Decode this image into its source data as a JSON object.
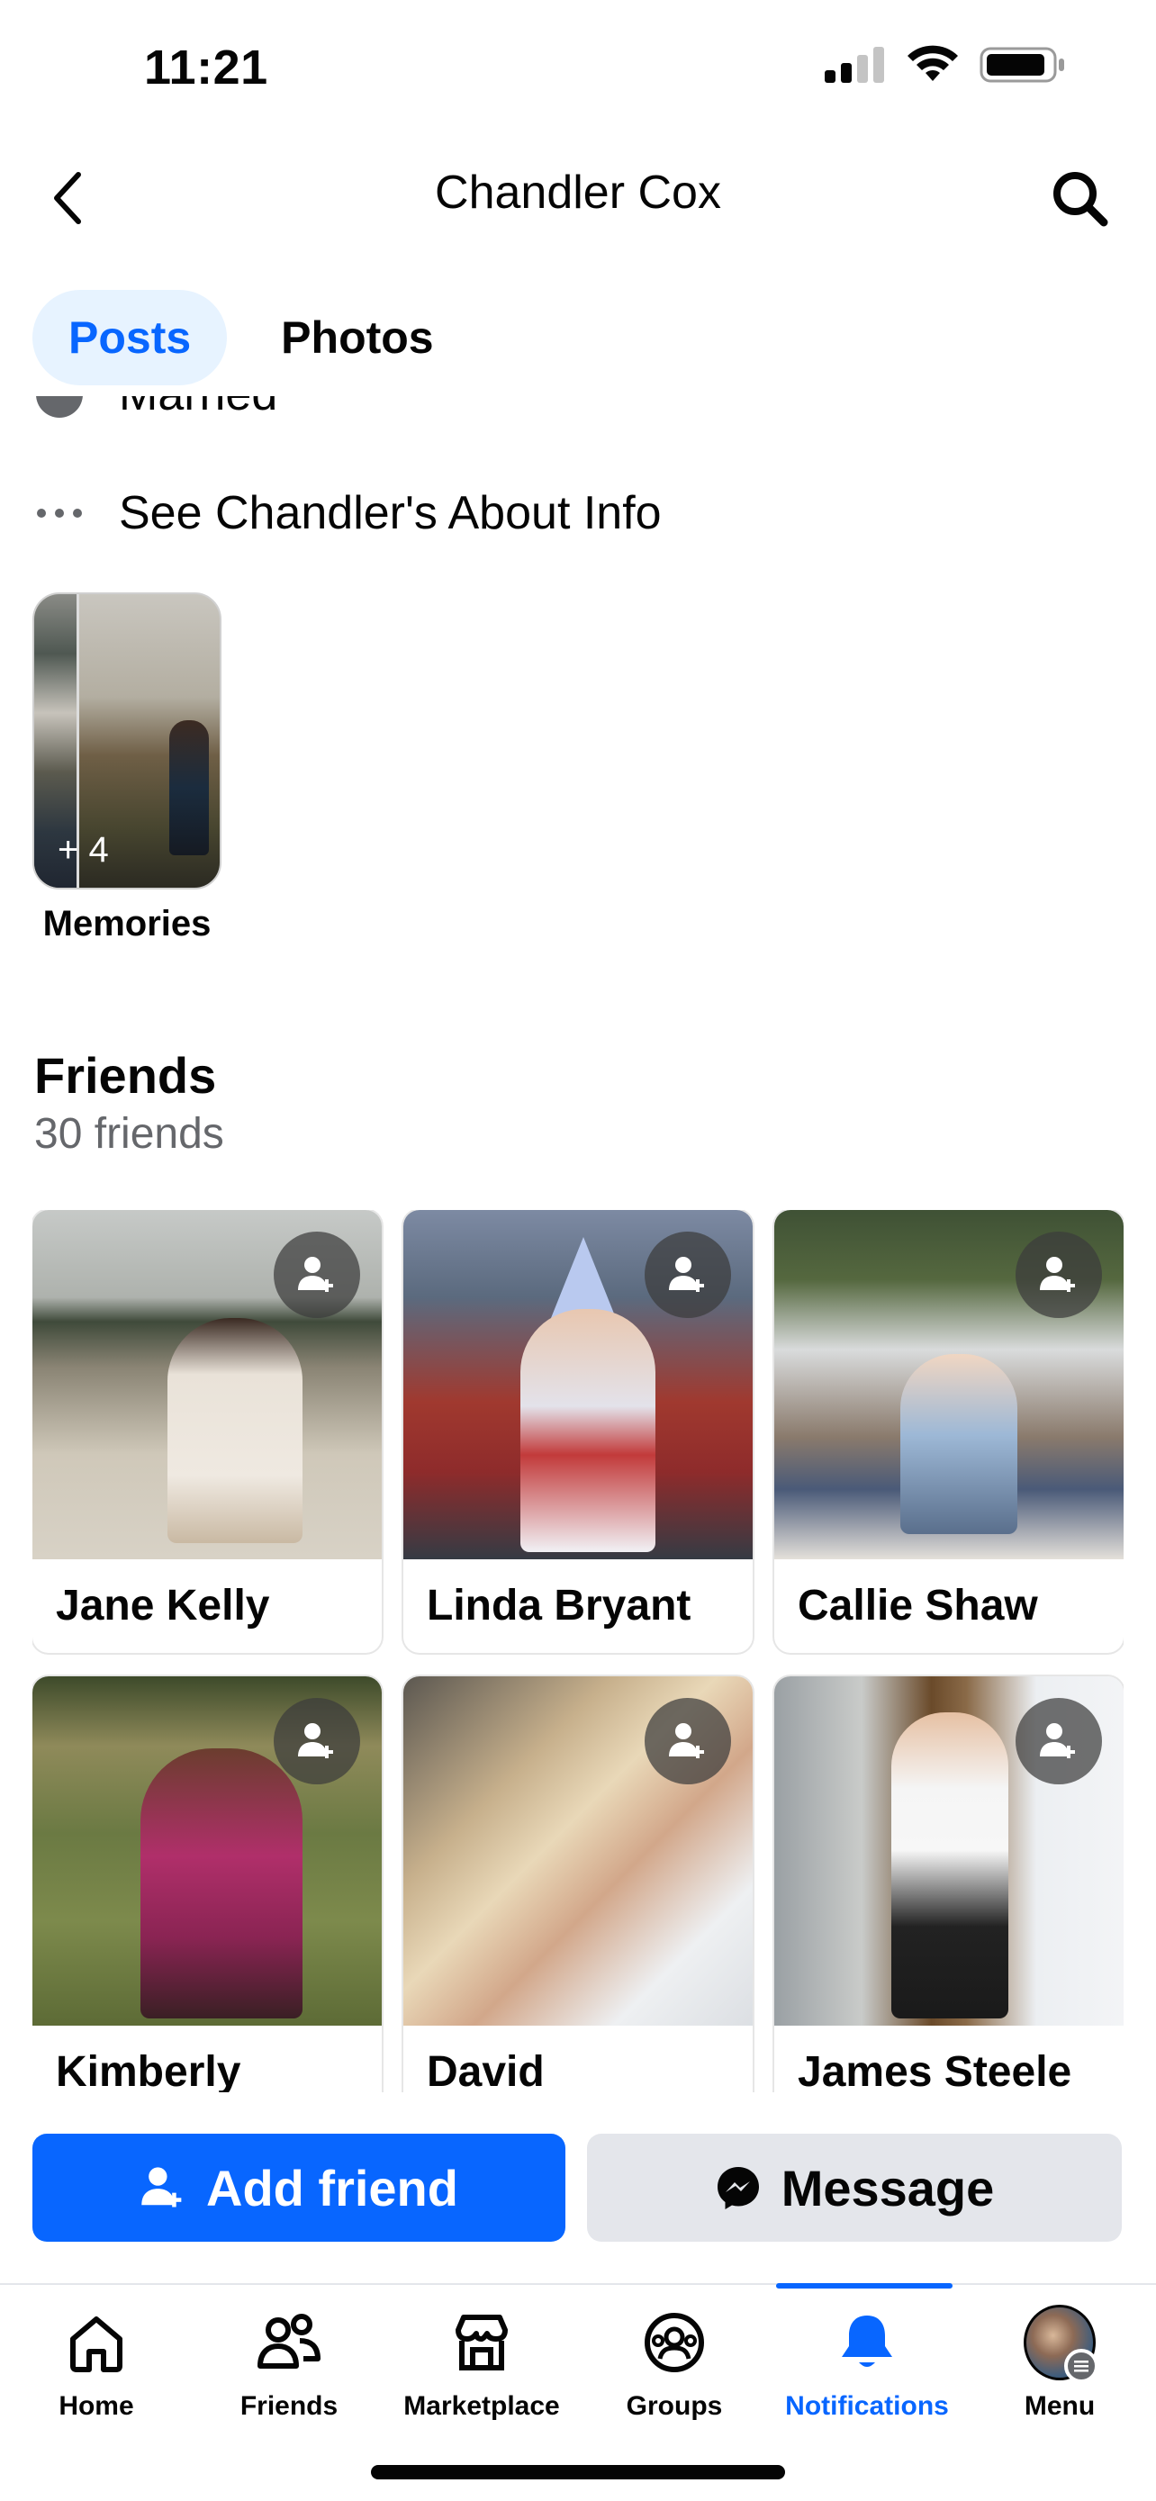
{
  "status": {
    "time": "11:21"
  },
  "header": {
    "title": "Chandler Cox"
  },
  "tabs": [
    {
      "label": "Posts",
      "active": true
    },
    {
      "label": "Photos",
      "active": false
    }
  ],
  "about": {
    "relationship": "Married",
    "see_about": "See Chandler's About Info"
  },
  "memories": {
    "label": "Memories",
    "more_count": "+ 4"
  },
  "friends": {
    "title": "Friends",
    "count": "30 friends",
    "items": [
      {
        "name": "Jane Kelly"
      },
      {
        "name": "Linda Bryant"
      },
      {
        "name": "Callie Shaw"
      },
      {
        "name": "Kimberly"
      },
      {
        "name": "David"
      },
      {
        "name": "James Steele"
      }
    ]
  },
  "actions": {
    "add_friend": "Add friend",
    "message": "Message"
  },
  "tabbar": {
    "items": [
      {
        "label": "Home",
        "icon": "home-icon"
      },
      {
        "label": "Friends",
        "icon": "friends-icon"
      },
      {
        "label": "Marketplace",
        "icon": "marketplace-icon"
      },
      {
        "label": "Groups",
        "icon": "groups-icon"
      },
      {
        "label": "Notifications",
        "icon": "bell-icon",
        "active": true
      },
      {
        "label": "Menu",
        "icon": "avatar"
      }
    ]
  },
  "colors": {
    "accent": "#0866ff",
    "tab_active_bg": "#e7f3ff",
    "secondary_text": "#65676b",
    "button_gray": "#e4e6eb"
  }
}
